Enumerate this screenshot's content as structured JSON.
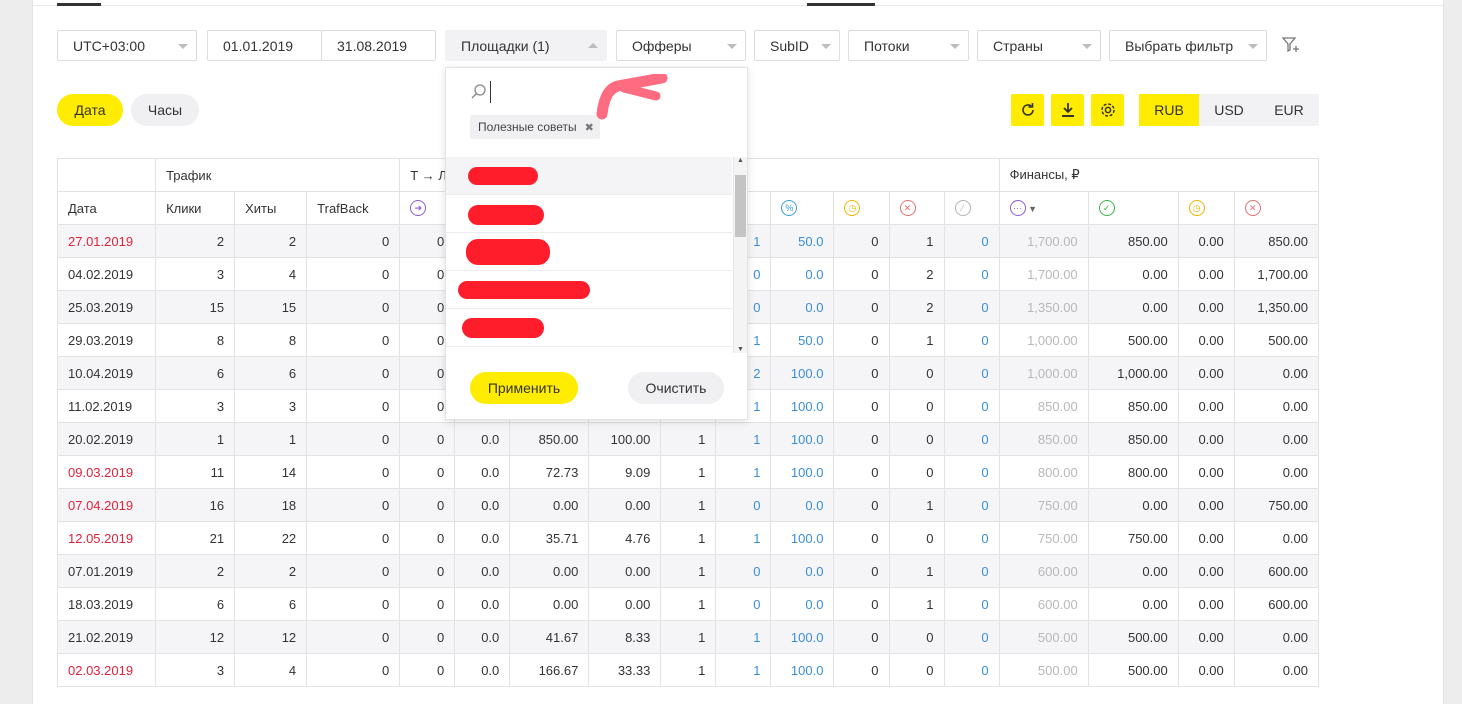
{
  "filters": {
    "timezone": "UTC+03:00",
    "date_from": "01.01.2019",
    "date_to": "31.08.2019",
    "sites": "Площадки (1)",
    "offers": "Офферы",
    "subid": "SubID",
    "flows": "Потоки",
    "countries": "Страны",
    "choose_filter": "Выбрать фильтр"
  },
  "group": {
    "date": "Дата",
    "hours": "Часы"
  },
  "currencies": [
    "RUB",
    "USD",
    "EUR"
  ],
  "accent": "#ffec00",
  "dropdown": {
    "search_placeholder": "",
    "tag": "Полезные советы",
    "apply": "Применить",
    "clear": "Очистить"
  },
  "table": {
    "group_headers": {
      "traffic": "Трафик",
      "conversion": "Т → Л",
      "finance": "Финансы, ₽"
    },
    "headers": [
      "Дата",
      "Клики",
      "Хиты",
      "TrafBack"
    ],
    "rows": [
      {
        "date": "27.01.2019",
        "weekend": true,
        "c": [
          "2",
          "2",
          "0",
          "0",
          "",
          "",
          "",
          "",
          "",
          "1",
          "50.0",
          "0",
          "1",
          "0",
          "1,700.00",
          "850.00",
          "0.00",
          "850.00"
        ]
      },
      {
        "date": "04.02.2019",
        "weekend": false,
        "c": [
          "3",
          "4",
          "0",
          "0",
          "",
          "",
          "",
          "",
          "",
          "0",
          "0.0",
          "0",
          "2",
          "0",
          "1,700.00",
          "0.00",
          "0.00",
          "1,700.00"
        ]
      },
      {
        "date": "25.03.2019",
        "weekend": false,
        "c": [
          "15",
          "15",
          "0",
          "0",
          "",
          "",
          "",
          "",
          "",
          "0",
          "0.0",
          "0",
          "2",
          "0",
          "1,350.00",
          "0.00",
          "0.00",
          "1,350.00"
        ]
      },
      {
        "date": "29.03.2019",
        "weekend": false,
        "c": [
          "8",
          "8",
          "0",
          "0",
          "",
          "",
          "",
          "",
          "",
          "1",
          "50.0",
          "0",
          "1",
          "0",
          "1,000.00",
          "500.00",
          "0.00",
          "500.00"
        ]
      },
      {
        "date": "10.04.2019",
        "weekend": false,
        "c": [
          "6",
          "6",
          "0",
          "0",
          "",
          "",
          "",
          "",
          "",
          "2",
          "100.0",
          "0",
          "0",
          "0",
          "1,000.00",
          "1,000.00",
          "0.00",
          "0.00"
        ]
      },
      {
        "date": "11.02.2019",
        "weekend": false,
        "c": [
          "3",
          "3",
          "0",
          "0",
          "",
          "",
          "",
          "",
          "",
          "1",
          "100.0",
          "0",
          "0",
          "0",
          "850.00",
          "850.00",
          "0.00",
          "0.00"
        ]
      },
      {
        "date": "20.02.2019",
        "weekend": false,
        "c": [
          "1",
          "1",
          "0",
          "0",
          "0.0",
          "850.00",
          "100.00",
          "1",
          "1",
          "100.0",
          "0",
          "0",
          "0",
          "850.00",
          "850.00",
          "0.00",
          "0.00"
        ]
      },
      {
        "date": "09.03.2019",
        "weekend": true,
        "c": [
          "11",
          "14",
          "0",
          "0",
          "0.0",
          "72.73",
          "9.09",
          "1",
          "1",
          "100.0",
          "0",
          "0",
          "0",
          "800.00",
          "800.00",
          "0.00",
          "0.00"
        ]
      },
      {
        "date": "07.04.2019",
        "weekend": true,
        "c": [
          "16",
          "18",
          "0",
          "0",
          "0.0",
          "0.00",
          "0.00",
          "1",
          "0",
          "0.0",
          "0",
          "1",
          "0",
          "750.00",
          "0.00",
          "0.00",
          "750.00"
        ]
      },
      {
        "date": "12.05.2019",
        "weekend": true,
        "c": [
          "21",
          "22",
          "0",
          "0",
          "0.0",
          "35.71",
          "4.76",
          "1",
          "1",
          "100.0",
          "0",
          "0",
          "0",
          "750.00",
          "750.00",
          "0.00",
          "0.00"
        ]
      },
      {
        "date": "07.01.2019",
        "weekend": false,
        "c": [
          "2",
          "2",
          "0",
          "0",
          "0.0",
          "0.00",
          "0.00",
          "1",
          "0",
          "0.0",
          "0",
          "1",
          "0",
          "600.00",
          "0.00",
          "0.00",
          "600.00"
        ]
      },
      {
        "date": "18.03.2019",
        "weekend": false,
        "c": [
          "6",
          "6",
          "0",
          "0",
          "0.0",
          "0.00",
          "0.00",
          "1",
          "0",
          "0.0",
          "0",
          "1",
          "0",
          "600.00",
          "0.00",
          "0.00",
          "600.00"
        ]
      },
      {
        "date": "21.02.2019",
        "weekend": false,
        "c": [
          "12",
          "12",
          "0",
          "0",
          "0.0",
          "41.67",
          "8.33",
          "1",
          "1",
          "100.0",
          "0",
          "0",
          "0",
          "500.00",
          "500.00",
          "0.00",
          "0.00"
        ]
      },
      {
        "date": "02.03.2019",
        "weekend": true,
        "c": [
          "3",
          "4",
          "0",
          "0",
          "0.0",
          "166.67",
          "33.33",
          "1",
          "1",
          "100.0",
          "0",
          "0",
          "0",
          "500.00",
          "500.00",
          "0.00",
          "0.00"
        ]
      }
    ]
  }
}
